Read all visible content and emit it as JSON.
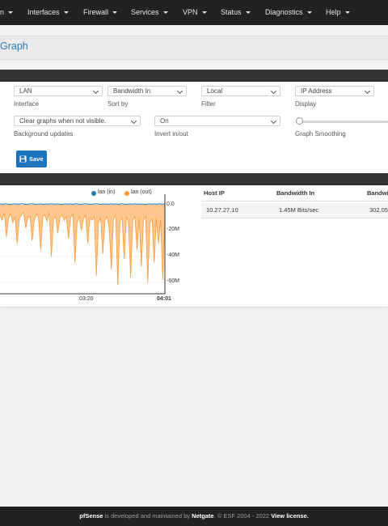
{
  "nav": {
    "items": [
      {
        "label": "n"
      },
      {
        "label": "Interfaces"
      },
      {
        "label": "Firewall"
      },
      {
        "label": "Services"
      },
      {
        "label": "VPN"
      },
      {
        "label": "Status"
      },
      {
        "label": "Diagnostics"
      },
      {
        "label": "Help"
      }
    ]
  },
  "page": {
    "title": "Graph"
  },
  "settings": {
    "interface": {
      "value": "LAN",
      "label": "Interface"
    },
    "sort_by": {
      "value": "Bandwidth In",
      "label": "Sort by"
    },
    "filter": {
      "value": "Local",
      "label": "Filter"
    },
    "display": {
      "value": "IP Address",
      "label": "Display"
    },
    "background_updates": {
      "value": "Clear graphs when not visible.",
      "label": "Background updates"
    },
    "invert": {
      "value": "On",
      "label": "Invert in/out"
    },
    "smoothing": {
      "label": "Graph Smoothing",
      "level": 0
    },
    "save_label": "Save"
  },
  "graph": {
    "legend": [
      {
        "name": "lan (in)",
        "color": "#1f77b4"
      },
      {
        "name": "lan (out)",
        "color": "#ff9933"
      }
    ],
    "y_ticks": [
      "0.0",
      "-20M",
      "-40M",
      "-60M"
    ],
    "x_ticks": [
      "03:20",
      "04:01"
    ]
  },
  "table": {
    "headers": [
      "Host IP",
      "Bandwidth In",
      "Bandwi"
    ],
    "rows": [
      [
        "10.27.27.10",
        "1.45M Bits/sec",
        "302.05"
      ]
    ]
  },
  "footer": {
    "brand": "pfSense",
    "text1": " is developed and maintained by ",
    "company": "Netgate",
    "text2": ". © ESF 2004 - 2022 ",
    "license": "View license."
  },
  "chart_data": {
    "type": "area",
    "series": [
      {
        "name": "lan (in)",
        "color": "#1f77b4",
        "values": [
          0.6,
          0.4,
          0.8,
          0.5,
          0.3,
          0.7,
          0.6,
          0.4,
          0.9,
          0.5,
          0.3,
          0.6,
          0.8,
          0.4,
          0.5,
          0.7,
          0.3,
          0.6,
          0.5,
          0.8,
          0.4,
          0.6,
          0.5,
          0.3,
          0.7,
          0.5,
          0.6,
          0.4,
          0.8,
          0.5,
          0.3,
          0.6,
          0.7,
          0.4,
          0.5,
          0.6,
          0.8,
          0.3,
          0.5,
          0.6,
          0.4,
          0.7,
          0.5,
          0.6,
          0.3,
          0.8,
          0.5,
          0.4,
          0.6,
          0.5,
          0.7,
          0.4,
          0.6,
          0.5,
          0.3,
          0.7,
          0.5,
          0.6,
          0.4,
          0.8,
          0.5,
          0.6
        ]
      },
      {
        "name": "lan (out)",
        "color": "#ff9933",
        "values": [
          -8,
          -12,
          -6,
          -25,
          -10,
          -7,
          -14,
          -9,
          -30,
          -11,
          -8,
          -6,
          -18,
          -10,
          -9,
          -28,
          -12,
          -7,
          -10,
          -35,
          -9,
          -8,
          -13,
          -6,
          -40,
          -11,
          -9,
          -22,
          -10,
          -8,
          -12,
          -9,
          -26,
          -10,
          -7,
          -45,
          -14,
          -9,
          -20,
          -11,
          -8,
          -30,
          -10,
          -12,
          -9,
          -55,
          -14,
          -10,
          -38,
          -12,
          -9,
          -18,
          -50,
          -11,
          -8,
          -62,
          -13,
          -10,
          -42,
          -9,
          -14,
          -56,
          -12,
          -9,
          -35,
          -10,
          -48,
          -12,
          -9,
          -60,
          -14,
          -11,
          -45,
          -10,
          -30,
          -12,
          -58,
          -10
        ]
      }
    ],
    "ylim": [
      -64,
      2
    ],
    "y_ticks": [
      "0.0",
      "-20M",
      "-40M",
      "-60M"
    ],
    "x_ticks": [
      "03:20",
      "04:01"
    ],
    "legend_position": "top-right"
  }
}
